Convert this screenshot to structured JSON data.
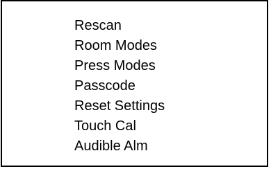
{
  "menu": {
    "items": [
      {
        "label": "Rescan"
      },
      {
        "label": "Room Modes"
      },
      {
        "label": "Press Modes"
      },
      {
        "label": "Passcode"
      },
      {
        "label": "Reset Settings"
      },
      {
        "label": "Touch Cal"
      },
      {
        "label": "Audible Alm"
      }
    ]
  }
}
